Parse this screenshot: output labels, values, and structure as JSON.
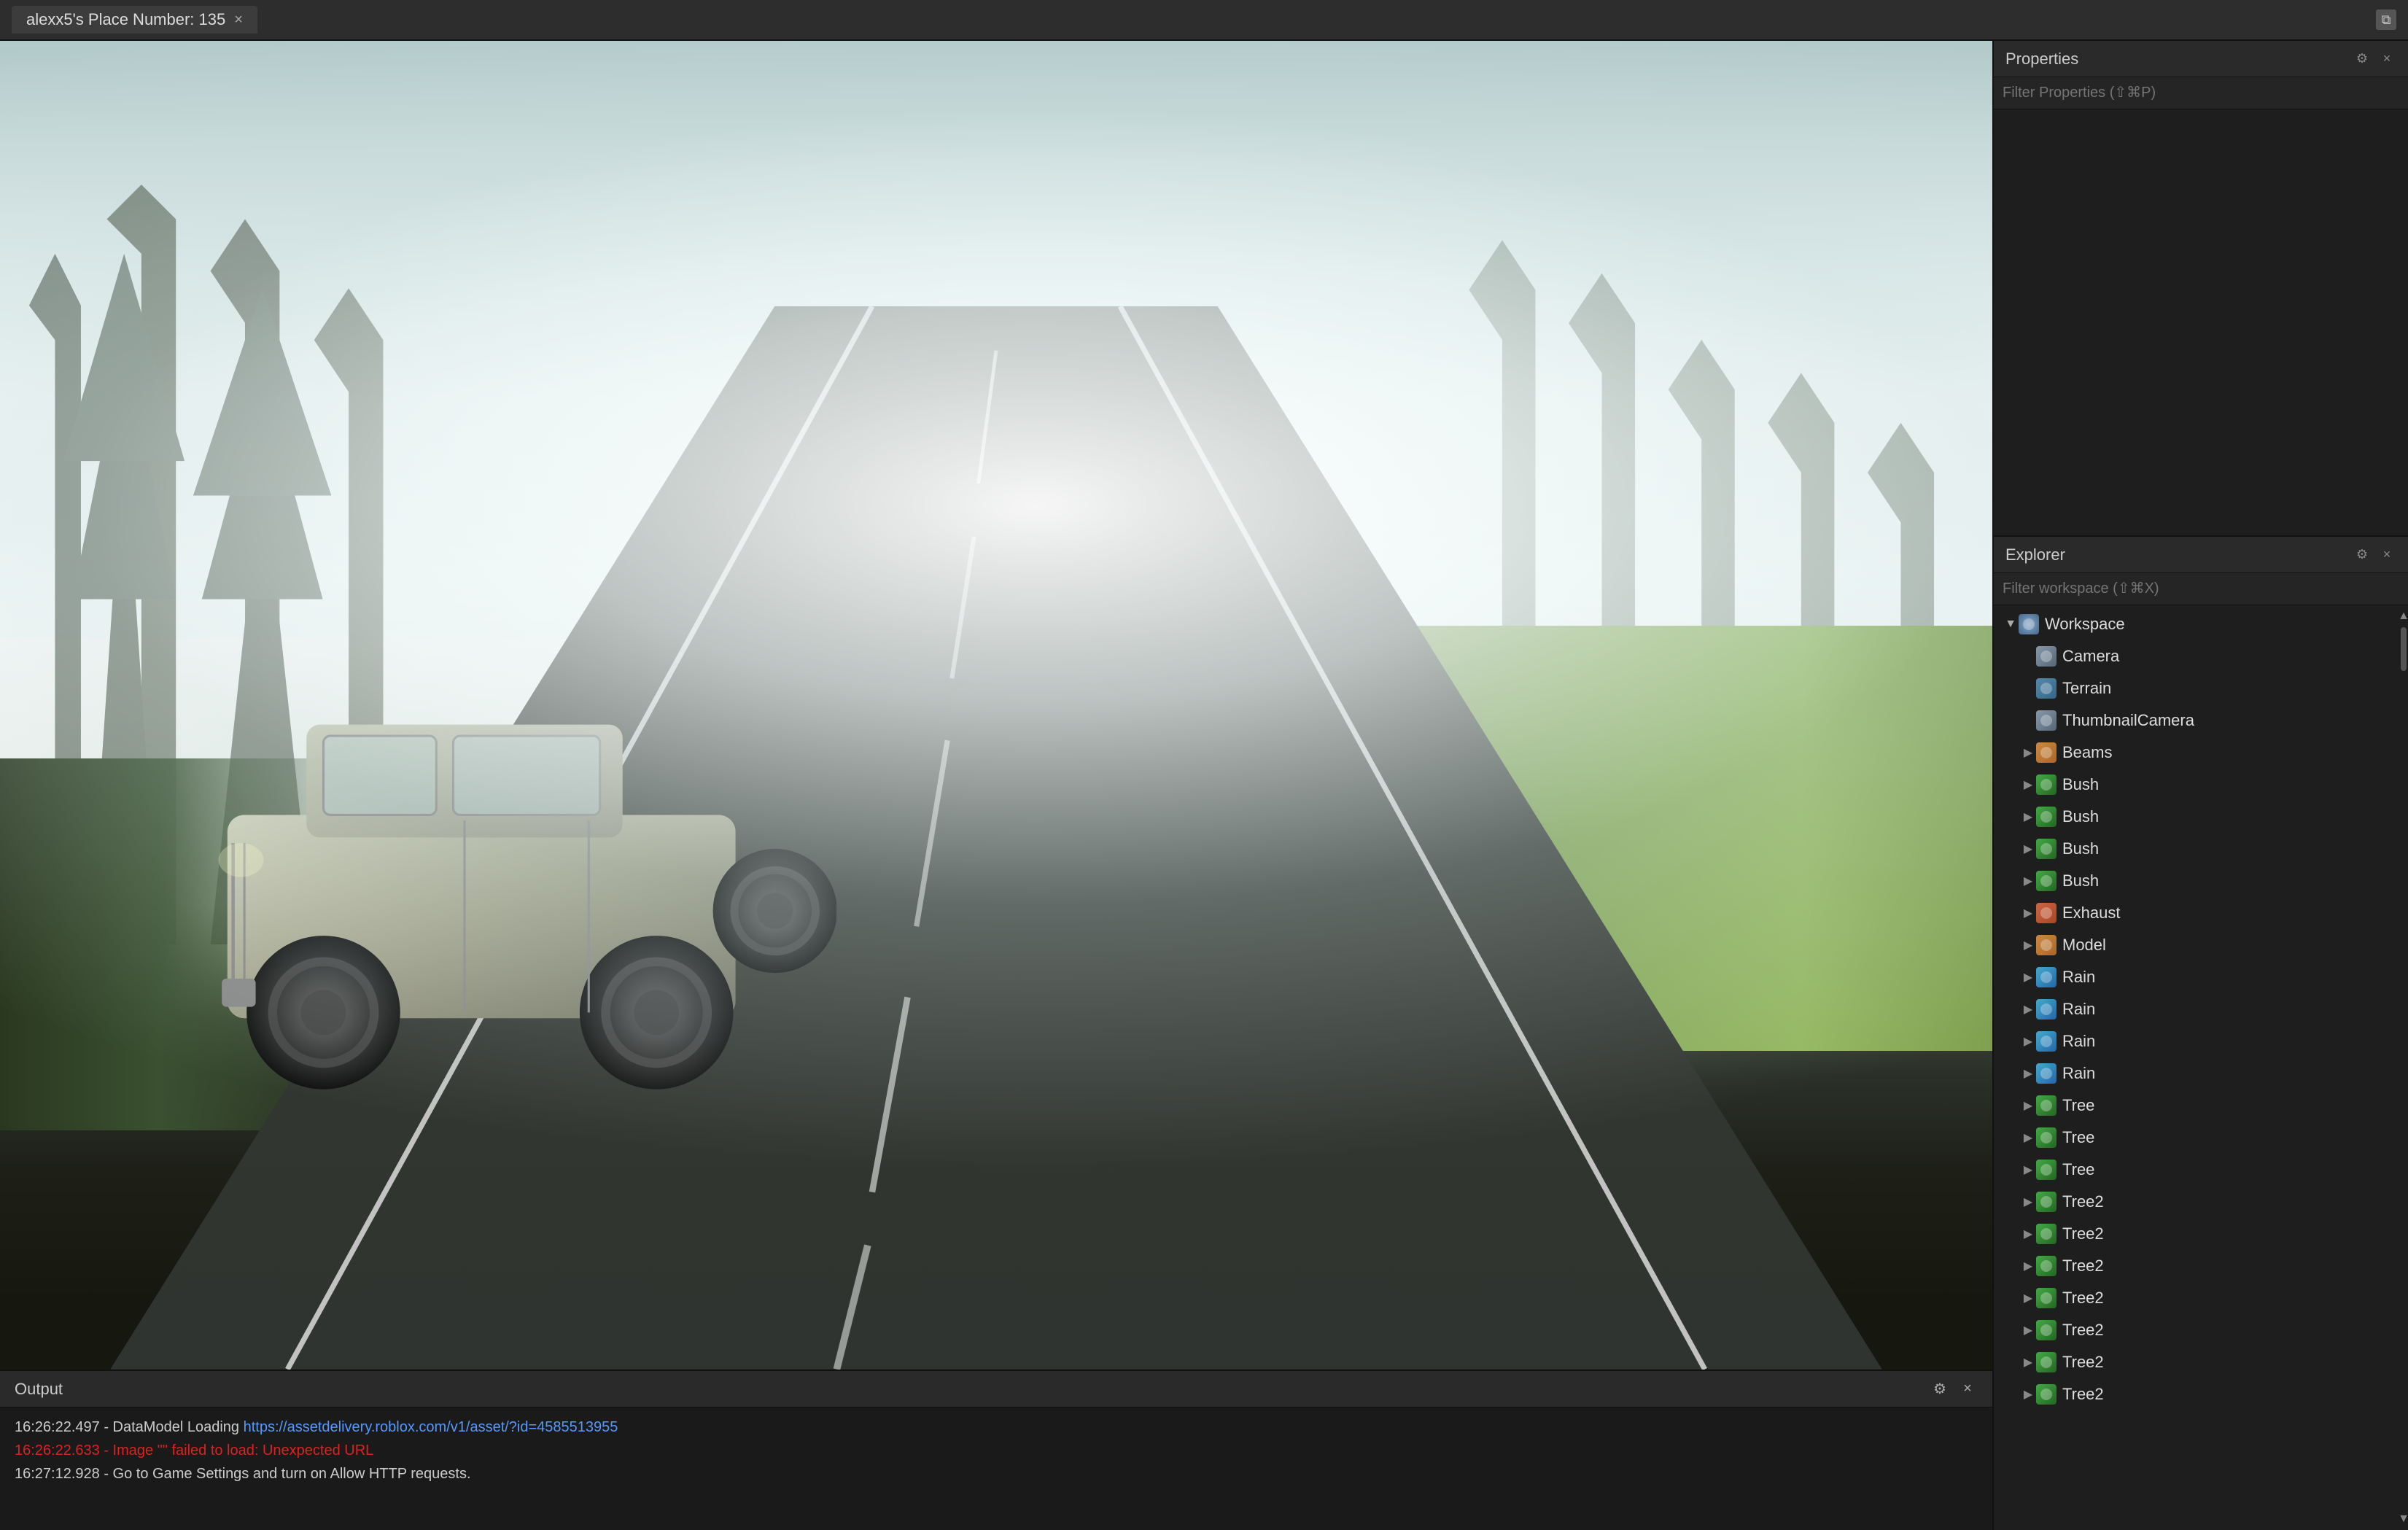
{
  "titleBar": {
    "tab_label": "alexx5's Place Number: 135",
    "close_label": "×",
    "restore_icon": "⧉"
  },
  "propertiesPanel": {
    "title": "Properties",
    "filter_placeholder": "Filter Properties (⇧⌘P)",
    "close_icon": "×",
    "settings_icon": "⚙"
  },
  "explorerPanel": {
    "title": "Explorer",
    "filter_placeholder": "Filter workspace (⇧⌘X)",
    "close_icon": "×",
    "settings_icon": "⚙",
    "items": [
      {
        "id": "workspace",
        "label": "Workspace",
        "icon": "workspace",
        "indent": 0,
        "expanded": true,
        "has_arrow": true
      },
      {
        "id": "camera",
        "label": "Camera",
        "icon": "camera",
        "indent": 1,
        "expanded": false,
        "has_arrow": false
      },
      {
        "id": "terrain",
        "label": "Terrain",
        "icon": "terrain",
        "indent": 1,
        "expanded": false,
        "has_arrow": false
      },
      {
        "id": "thumbnail",
        "label": "ThumbnailCamera",
        "icon": "thumbnail",
        "indent": 1,
        "expanded": false,
        "has_arrow": false
      },
      {
        "id": "beams",
        "label": "Beams",
        "icon": "beams",
        "indent": 1,
        "expanded": false,
        "has_arrow": true
      },
      {
        "id": "bush1",
        "label": "Bush",
        "icon": "bush",
        "indent": 1,
        "expanded": false,
        "has_arrow": true
      },
      {
        "id": "bush2",
        "label": "Bush",
        "icon": "bush",
        "indent": 1,
        "expanded": false,
        "has_arrow": true
      },
      {
        "id": "bush3",
        "label": "Bush",
        "icon": "bush",
        "indent": 1,
        "expanded": false,
        "has_arrow": true
      },
      {
        "id": "bush4",
        "label": "Bush",
        "icon": "bush",
        "indent": 1,
        "expanded": false,
        "has_arrow": true
      },
      {
        "id": "exhaust",
        "label": "Exhaust",
        "icon": "exhaust",
        "indent": 1,
        "expanded": false,
        "has_arrow": true
      },
      {
        "id": "model",
        "label": "Model",
        "icon": "model",
        "indent": 1,
        "expanded": false,
        "has_arrow": true
      },
      {
        "id": "rain1",
        "label": "Rain",
        "icon": "rain",
        "indent": 1,
        "expanded": false,
        "has_arrow": true
      },
      {
        "id": "rain2",
        "label": "Rain",
        "icon": "rain",
        "indent": 1,
        "expanded": false,
        "has_arrow": true
      },
      {
        "id": "rain3",
        "label": "Rain",
        "icon": "rain",
        "indent": 1,
        "expanded": false,
        "has_arrow": true
      },
      {
        "id": "rain4",
        "label": "Rain",
        "icon": "rain",
        "indent": 1,
        "expanded": false,
        "has_arrow": true
      },
      {
        "id": "tree1",
        "label": "Tree",
        "icon": "tree",
        "indent": 1,
        "expanded": false,
        "has_arrow": true
      },
      {
        "id": "tree2",
        "label": "Tree",
        "icon": "tree",
        "indent": 1,
        "expanded": false,
        "has_arrow": true
      },
      {
        "id": "tree3",
        "label": "Tree",
        "icon": "tree",
        "indent": 1,
        "expanded": false,
        "has_arrow": true
      },
      {
        "id": "tree2a",
        "label": "Tree2",
        "icon": "tree",
        "indent": 1,
        "expanded": false,
        "has_arrow": true
      },
      {
        "id": "tree2b",
        "label": "Tree2",
        "icon": "tree",
        "indent": 1,
        "expanded": false,
        "has_arrow": true
      },
      {
        "id": "tree2c",
        "label": "Tree2",
        "icon": "tree",
        "indent": 1,
        "expanded": false,
        "has_arrow": true
      },
      {
        "id": "tree2d",
        "label": "Tree2",
        "icon": "tree",
        "indent": 1,
        "expanded": false,
        "has_arrow": true
      },
      {
        "id": "tree2e",
        "label": "Tree2",
        "icon": "tree",
        "indent": 1,
        "expanded": false,
        "has_arrow": true
      },
      {
        "id": "tree2f",
        "label": "Tree2",
        "icon": "tree",
        "indent": 1,
        "expanded": false,
        "has_arrow": true
      },
      {
        "id": "tree2g",
        "label": "Tree2",
        "icon": "tree",
        "indent": 1,
        "expanded": false,
        "has_arrow": true
      }
    ]
  },
  "outputPanel": {
    "title": "Output",
    "logs": [
      {
        "id": "log1",
        "text": "16:26:22.497 - DataModel Loading https://assetdelivery.roblox.com/v1/asset/?id=4585513955",
        "type": "normal",
        "url": "https://assetdelivery.roblox.com/v1/asset/?id=4585513955"
      },
      {
        "id": "log2",
        "text": "16:26:22.633 - Image \"\" failed to load: Unexpected URL",
        "type": "error"
      },
      {
        "id": "log3",
        "text": "16:27:12.928 - Go to Game Settings and turn on Allow HTTP requests.",
        "type": "normal"
      }
    ]
  }
}
